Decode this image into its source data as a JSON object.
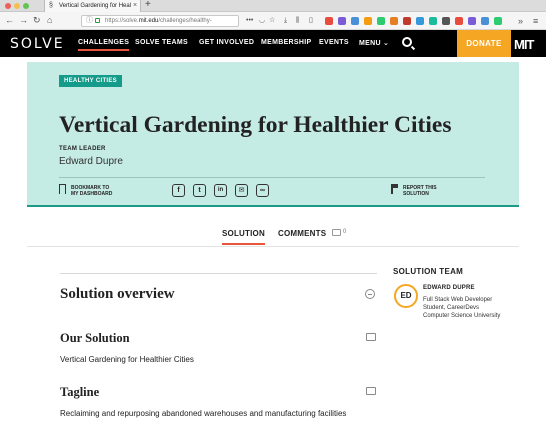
{
  "browser": {
    "tab_title": "Vertical Gardening for Healthier Cities",
    "url_prefix": "https://solve.",
    "url_domain": "mit.edu",
    "url_path": "/challenges/healthy-",
    "new_tab_glyph": "+",
    "tab_close_glyph": "×",
    "back_glyph": "←",
    "forward_glyph": "→",
    "reload_glyph": "↻",
    "home_glyph": "⌂",
    "more_glyph": "»",
    "menu_glyph": "≡",
    "page_actions_glyph": "•••",
    "bookmark_star_glyph": "☆",
    "library_glyph": "⫼",
    "download_glyph": "⤓",
    "traffic_lights": [
      "#ee5f57",
      "#f4bf4f",
      "#61c554"
    ],
    "extension_colors": [
      "#e74c3c",
      "#7b5cd6",
      "#4a90d9",
      "#f39c12",
      "#2ecc71",
      "#e67e22",
      "#c0392b",
      "#3498db",
      "#1abc9c",
      "#555555"
    ]
  },
  "nav": {
    "logo": "SOLVE",
    "items": [
      "CHALLENGES",
      "SOLVE TEAMS",
      "GET INVOLVED",
      "MEMBERSHIP",
      "EVENTS",
      "MENU ⌄"
    ],
    "donate": "DONATE",
    "mit_logo": "MIT",
    "accent": "#e9563c",
    "donate_color": "#f5a623"
  },
  "hero": {
    "badge": "HEALTHY CITIES",
    "title": "Vertical Gardening for Healthier Cities",
    "team_leader_label": "TEAM LEADER",
    "team_leader_name": "Edward Dupre",
    "bookmark_line1": "BOOKMARK TO",
    "bookmark_line2": "MY DASHBOARD",
    "share_icons": [
      "f",
      "t",
      "in",
      "✉",
      "∞"
    ],
    "report_line1": "REPORT THIS",
    "report_line2": "SOLUTION",
    "background": "#c5ebe5",
    "badge_color": "#159b89"
  },
  "tabs": {
    "solution": "SOLUTION",
    "comments": "COMMENTS",
    "comment_count": "0"
  },
  "main": {
    "overview_title": "Solution overview",
    "sections": [
      {
        "heading": "Our Solution",
        "text": "Vertical Gardening for Healthier Cities"
      },
      {
        "heading": "Tagline",
        "text": "Reclaiming and repurposing abandoned warehouses and manufacturing facilities"
      }
    ]
  },
  "side": {
    "heading": "SOLUTION TEAM",
    "member_initials": "ED",
    "member_name": "EDWARD DUPRE",
    "member_bio": "Full Stack Web Developer Student, CareerDevs Computer Science University"
  }
}
